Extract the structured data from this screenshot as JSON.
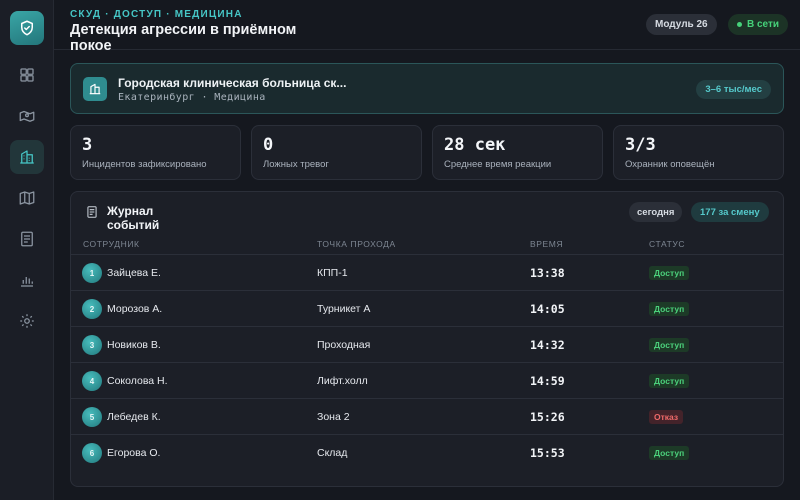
{
  "header": {
    "breadcrumb": "СКУД · ДОСТУП · МЕДИЦИНА",
    "title": "Детекция агрессии в приёмном покое",
    "module": "Модуль 26",
    "status": "В сети"
  },
  "sidebar": {
    "items": [
      {
        "icon": "grid-icon",
        "active": false
      },
      {
        "icon": "map-pin-icon",
        "active": false
      },
      {
        "icon": "building-icon",
        "active": true
      },
      {
        "icon": "map-icon",
        "active": false
      },
      {
        "icon": "document-icon",
        "active": false
      },
      {
        "icon": "bar-chart-icon",
        "active": false
      },
      {
        "icon": "gear-icon",
        "active": false
      }
    ]
  },
  "org": {
    "name": "Городская клиническая больница ск...",
    "subtitle": "Екатеринбург · Медицина",
    "price": "3–6 тыс/мес"
  },
  "stats": [
    {
      "value": "3",
      "label": "Инцидентов зафиксировано"
    },
    {
      "value": "0",
      "label": "Ложных тревог"
    },
    {
      "value": "28 сек",
      "label": "Среднее время реакции"
    },
    {
      "value": "3/3",
      "label": "Охранник оповещён"
    }
  ],
  "journal": {
    "title": "Журнал событий",
    "period": "сегодня",
    "shift_count": "177 за смену",
    "columns": [
      "СОТРУДНИК",
      "ТОЧКА ПРОХОДА",
      "ВРЕМЯ",
      "СТАТУС"
    ],
    "rows": [
      {
        "num": "1",
        "name": "Зайцева Е.",
        "point": "КПП-1",
        "time": "13:38",
        "status": "Доступ",
        "kind": "ok"
      },
      {
        "num": "2",
        "name": "Морозов А.",
        "point": "Турникет А",
        "time": "14:05",
        "status": "Доступ",
        "kind": "ok"
      },
      {
        "num": "3",
        "name": "Новиков В.",
        "point": "Проходная",
        "time": "14:32",
        "status": "Доступ",
        "kind": "ok"
      },
      {
        "num": "4",
        "name": "Соколова Н.",
        "point": "Лифт.холл",
        "time": "14:59",
        "status": "Доступ",
        "kind": "ok"
      },
      {
        "num": "5",
        "name": "Лебедев К.",
        "point": "Зона 2",
        "time": "15:26",
        "status": "Отказ",
        "kind": "deny"
      },
      {
        "num": "6",
        "name": "Егорова О.",
        "point": "Склад",
        "time": "15:53",
        "status": "Доступ",
        "kind": "ok"
      }
    ]
  },
  "colors": {
    "accent": "#46c6c6",
    "ok": "#4bd17b",
    "deny": "#f06a6a",
    "background": "#15181f"
  }
}
